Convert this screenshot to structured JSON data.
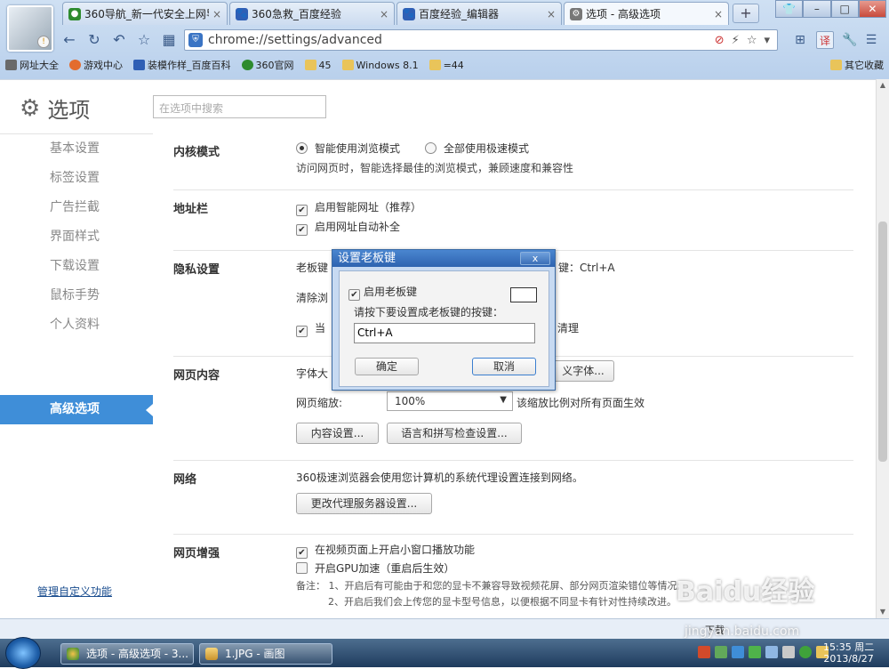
{
  "tabs": [
    {
      "label": "360导航_新一代安全上网导",
      "close": "×",
      "icon_color": "#2e8b2e"
    },
    {
      "label": "360急救_百度经验",
      "close": "×",
      "icon_color": "#2f5fb5"
    },
    {
      "label": "百度经验_编辑器",
      "close": "×",
      "icon_color": "#2f5fb5"
    },
    {
      "label": "选项 - 高级选项",
      "close": "×",
      "icon_color": "#777777"
    }
  ],
  "new_tab_label": "+",
  "window_buttons": {
    "shirt": "👕",
    "minimize": "–",
    "maximize": "□",
    "close": "✕"
  },
  "address_bar": {
    "url": "chrome://settings/advanced",
    "icon": "shield-icon"
  },
  "toolbar_right": {
    "translate": "译"
  },
  "bookmarks": [
    {
      "label": "网址大全",
      "type": "page",
      "color": "#6a6a6a"
    },
    {
      "label": "游戏中心",
      "type": "game",
      "color": "#e36c2e"
    },
    {
      "label": "装模作样_百度百科",
      "type": "baidu",
      "color": "#2f5fb5"
    },
    {
      "label": "360官网",
      "type": "360",
      "color": "#2e8b2e"
    },
    {
      "label": "45",
      "type": "folder",
      "color": "#e9c45a"
    },
    {
      "label": "Windows 8.1",
      "type": "folder",
      "color": "#e9c45a"
    },
    {
      "label": "=44",
      "type": "folder",
      "color": "#e9c45a"
    }
  ],
  "other_bookmarks": "其它收藏",
  "page": {
    "title": "选项",
    "search_placeholder": "在选项中搜索",
    "sidebar": [
      {
        "label": "基本设置"
      },
      {
        "label": "标签设置"
      },
      {
        "label": "广告拦截"
      },
      {
        "label": "界面样式"
      },
      {
        "label": "下载设置"
      },
      {
        "label": "鼠标手势"
      },
      {
        "label": "个人资料"
      },
      {
        "label": "高级选项",
        "active": true
      }
    ],
    "manage_link": "管理自定义功能",
    "kernel": {
      "heading": "内核模式",
      "option1": "智能使用浏览模式",
      "option2": "全部使用极速模式",
      "desc": "访问网页时，智能选择最佳的浏览模式，兼顾速度和兼容性"
    },
    "address": {
      "heading": "地址栏",
      "opt1": "启用智能网址（推荐）",
      "opt2": "启用网址自动补全"
    },
    "privacy": {
      "heading": "隐私设置",
      "boss_key_prefix": "老板键",
      "boss_key_suffix": "键：Ctrl+A",
      "clear_prefix": "清除浏",
      "when_prefix": "当",
      "clean_suffix": "清理"
    },
    "content": {
      "heading": "网页内容",
      "font_prefix": "字体大",
      "custom_font_btn": "义字体...",
      "zoom_label": "网页缩放:",
      "zoom_value": "100%",
      "zoom_desc": "该缩放比例对所有页面生效",
      "content_settings_btn": "内容设置...",
      "lang_btn": "语言和拼写检查设置..."
    },
    "network": {
      "heading": "网络",
      "desc": "360极速浏览器会使用您计算机的系统代理设置连接到网络。",
      "proxy_btn": "更改代理服务器设置..."
    },
    "enhance": {
      "heading": "网页增强",
      "opt1": "在视频页面上开启小窗口播放功能",
      "opt2": "开启GPU加速（重启后生效）",
      "note1": "备注：  1、开启后有可能由于和您的显卡不兼容导致视频花屏、部分网页渲染错位等情况;",
      "note2": "2、开启后我们会上传您的显卡型号信息，以便根据不同显卡有针对性持续改进。"
    }
  },
  "dialog": {
    "title": "设置老板键",
    "close": "x",
    "enable_label": "启用老板键",
    "prompt": "请按下要设置成老板键的按键：",
    "key_value": "Ctrl+A",
    "ok": "确定",
    "cancel": "取消"
  },
  "status_bar": {
    "download": "下载"
  },
  "taskbar": {
    "items": [
      {
        "label": "选项 - 高级选项 - 3..."
      },
      {
        "label": "1.JPG - 画图"
      }
    ],
    "time": "15:35 周二",
    "date": "2013/8/27"
  },
  "watermark": {
    "brand": "Baidu经验",
    "url": "jingyan.baidu.com"
  }
}
